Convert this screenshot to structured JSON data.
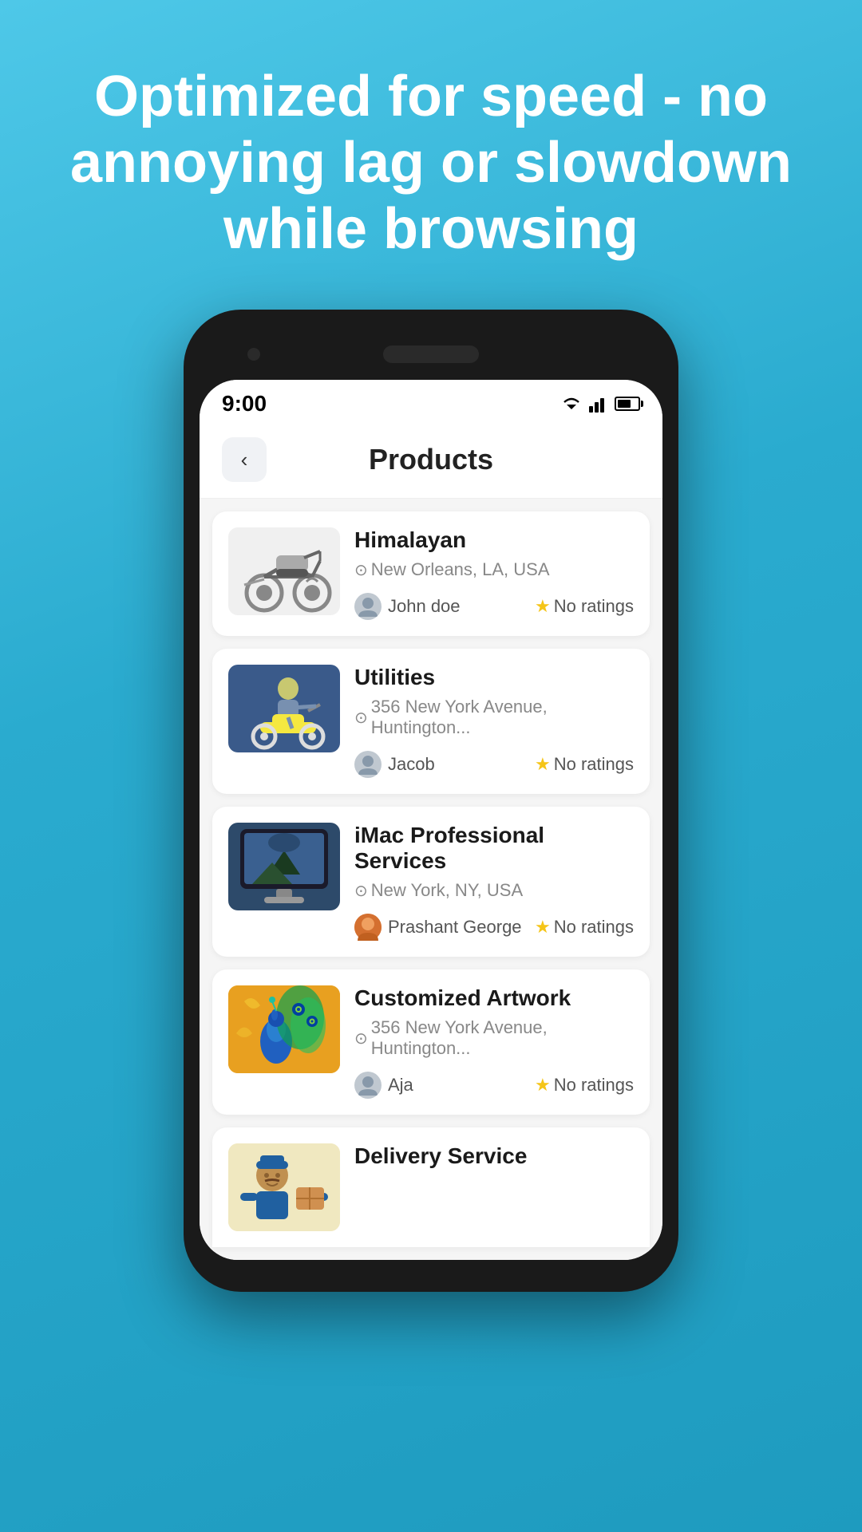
{
  "headline": "Optimized for speed - no annoying lag or slowdown while browsing",
  "status": {
    "time": "9:00"
  },
  "header": {
    "title": "Products",
    "back_label": "<"
  },
  "products": [
    {
      "id": "himalayan",
      "name": "Himalayan",
      "location": "New Orleans, LA, USA",
      "seller": "John doe",
      "rating": "No ratings",
      "image_type": "motorcycle-gray"
    },
    {
      "id": "utilities",
      "name": "Utilities",
      "location": "356 New York Avenue, Huntington...",
      "seller": "Jacob",
      "rating": "No ratings",
      "image_type": "scooter-blue"
    },
    {
      "id": "imac",
      "name": "iMac Professional Services",
      "location": "New York, NY, USA",
      "seller": "Prashant George",
      "rating": "No ratings",
      "image_type": "imac"
    },
    {
      "id": "artwork",
      "name": "Customized Artwork",
      "location": "356 New York Avenue, Huntington...",
      "seller": "Aja",
      "rating": "No ratings",
      "image_type": "peacock"
    },
    {
      "id": "delivery",
      "name": "Delivery Service",
      "location": "",
      "seller": "",
      "rating": "",
      "image_type": "delivery"
    }
  ],
  "icons": {
    "star": "★",
    "pin": "📍",
    "back": "‹"
  }
}
